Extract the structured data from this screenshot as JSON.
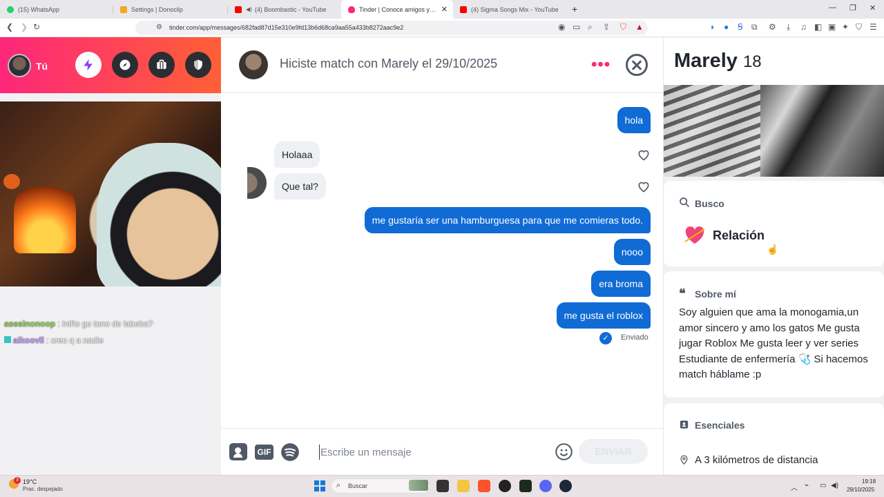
{
  "browser": {
    "tabs": [
      {
        "title": "(15) WhatsApp",
        "color": "#25d366"
      },
      {
        "title": "Settings | Donoclip",
        "color": "#f5a623"
      },
      {
        "title": "(4) Boombastic - YouTube",
        "color": "#ff0000"
      },
      {
        "title": "Tinder | Conoce amigos y gente",
        "color": "#fd267a"
      },
      {
        "title": "(4) Sigma Songs Mix - YouTube",
        "color": "#ff0000"
      }
    ],
    "active_tab_index": 3,
    "new_tab": "+",
    "url": "tinder.com/app/messages/682fad87d15e310e9fd13b6d68ca9aa55a433b8272aac9e2"
  },
  "left_header": {
    "me_label": "Tú",
    "nav_icons": [
      "bolt-icon",
      "compass-icon",
      "briefcase-icon",
      "shield-icon"
    ]
  },
  "stream_chat": [
    {
      "nick": "asesinonoop",
      "nick_color": "#8fd14f",
      "message": " : lniño go tono de labeba?"
    },
    {
      "nick": "aikoovll",
      "nick_color": "#c49bff",
      "message": " : creo q a nadie"
    }
  ],
  "conversation": {
    "title": "Hiciste match con Marely el 29/10/2025",
    "more_label": "•••",
    "messages": [
      {
        "direction": "out",
        "text": "hola"
      },
      {
        "direction": "in",
        "text": "Holaaa"
      },
      {
        "direction": "in",
        "text": "Que tal?"
      },
      {
        "direction": "out",
        "text": "me gustaría ser una hamburguesa para que me comieras todo."
      },
      {
        "direction": "out",
        "text": "nooo"
      },
      {
        "direction": "out",
        "text": "era broma"
      },
      {
        "direction": "out",
        "text": "me gusta el roblox"
      }
    ],
    "sent_status": "Enviado"
  },
  "composer": {
    "placeholder": "Escribe un mensaje",
    "gif_label": "GIF",
    "send_label": "ENVIAR"
  },
  "profile": {
    "name": "Marely",
    "age": "18",
    "looking_for": {
      "title": "Busco",
      "value": "Relación"
    },
    "about": {
      "title": "Sobre mí",
      "text": "Soy alguien que ama la monogamia,un amor sincero y amo los gatos Me gusta jugar Roblox Me gusta leer y ver series Estudiante de enfermería 🩺 Si hacemos match háblame :p"
    },
    "essentials": {
      "title": "Esenciales",
      "distance": "A 3 kilómetros de distancia"
    }
  },
  "taskbar": {
    "weather_temp": "19°C",
    "weather_desc": "Prac. despejado",
    "weather_badge": "3",
    "search_label": "Buscar",
    "time": "19:18",
    "date": "29/10/2025"
  },
  "colors": {
    "tinder_gradient_start": "#fd267a",
    "tinder_gradient_end": "#ff6036",
    "outgoing_bubble": "#106bd5",
    "incoming_bubble": "#eef0f3"
  }
}
